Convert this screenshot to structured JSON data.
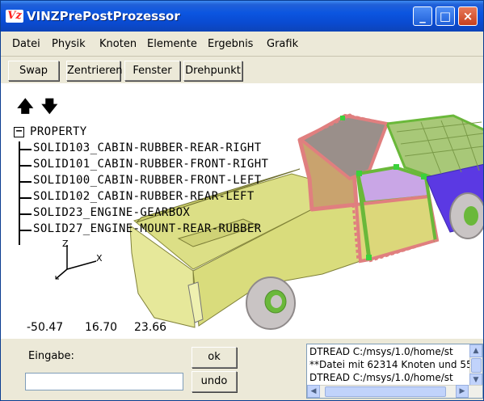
{
  "window": {
    "title": "VINZPrePostProzessor",
    "icon_text": "Vz",
    "controls": {
      "minimize": "_",
      "maximize": "□",
      "close": "×"
    }
  },
  "menu": [
    "Datei",
    "Physik",
    "Knoten",
    "Elemente",
    "Ergebnis",
    "Grafik"
  ],
  "toolbar": [
    "Swap",
    "Zentrieren",
    "Fenster",
    "Drehpunkt"
  ],
  "viewport": {
    "nav_up": "🡅",
    "nav_down": "🡇",
    "tree": {
      "root_label": "PROPERTY",
      "toggle": "−",
      "items": [
        "SOLID103_CABIN-RUBBER-REAR-RIGHT",
        "SOLID101_CABIN-RUBBER-FRONT-RIGHT",
        "SOLID100_CABIN-RUBBER-FRONT-LEFT",
        "SOLID102_CABIN-RUBBER-REAR-LEFT",
        "SOLID23_ENGINE-GEARBOX",
        "SOLID27_ENGINE-MOUNT-REAR-RUBBER"
      ]
    },
    "axes": {
      "z": "Z",
      "x": "X"
    },
    "coordinates": [
      "-50.47",
      "16.70",
      "23.66"
    ]
  },
  "input": {
    "label": "Eingabe:",
    "value": "",
    "placeholder": ""
  },
  "buttons": {
    "ok": "ok",
    "undo": "undo"
  },
  "log": [
    "DTREAD C:/msys/1.0/home/st",
    "**Datei mit 62314 Knoten und 55",
    "DTREAD C:/msys/1.0/home/st"
  ],
  "colors": {
    "truck_body": "#e3e68a",
    "cab_mesh": "#e07f7f",
    "cab_roof": "#9a8f8a",
    "window_glass": "#c9a6e6",
    "engine_green": "#6ab83a",
    "hood_blue": "#5b39e3",
    "wheel_grey": "#c9c4c4"
  }
}
